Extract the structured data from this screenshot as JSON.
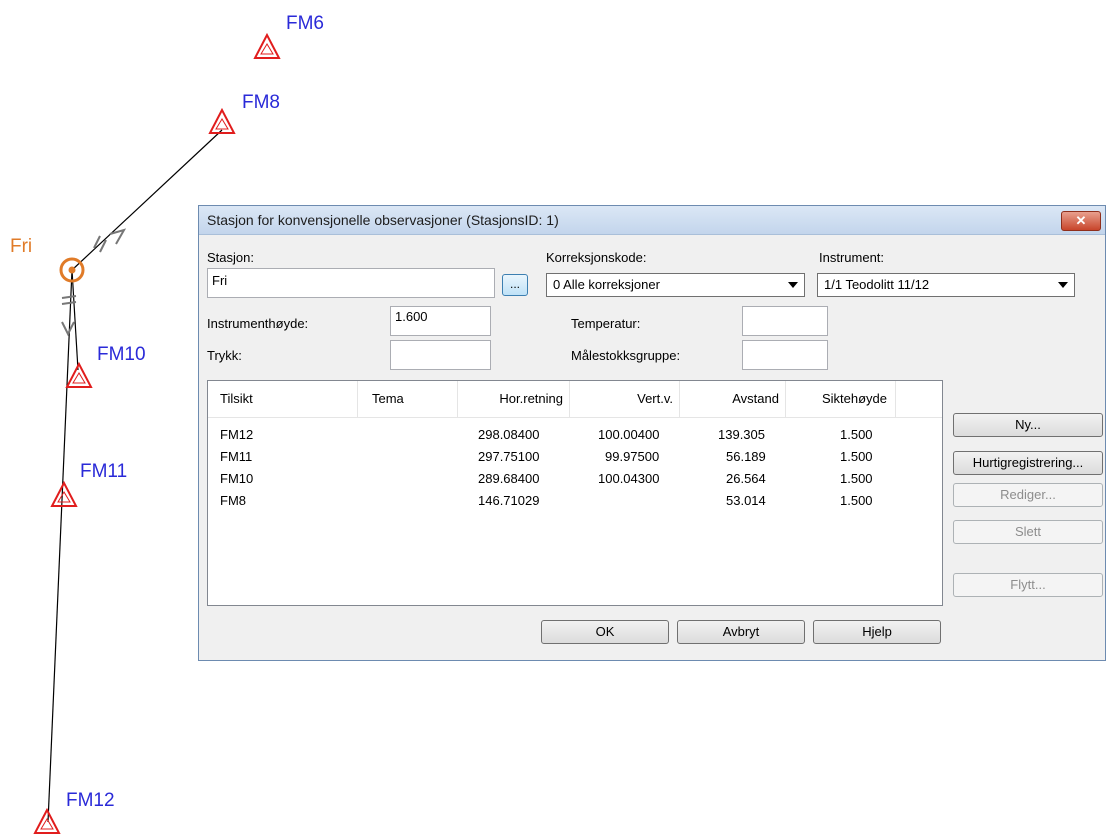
{
  "map": {
    "points": [
      {
        "name": "FM6"
      },
      {
        "name": "FM8"
      },
      {
        "name": "FM10"
      },
      {
        "name": "FM11"
      },
      {
        "name": "FM12"
      }
    ],
    "station_label": "Fri",
    "colors": {
      "point_symbol": "#e11d1d",
      "point_label": "#2a2ad8",
      "station": "#e07b28",
      "line": "#000000",
      "direction_marks": "#777777"
    }
  },
  "dialog": {
    "title": "Stasjon for konvensjonelle observasjoner (StasjonsID: 1)",
    "close_glyph": "✕",
    "stasjon_label": "Stasjon:",
    "stasjon_value": "Fri",
    "browse_label": "...",
    "korreksjonskode_label": "Korreksjonskode:",
    "korreksjonskode_value": "0  Alle korreksjoner",
    "instrument_label": "Instrument:",
    "instrument_value": "1/1   Teodolitt 11/12",
    "instrumenthoyde_label": "Instrumenthøyde:",
    "instrumenthoyde_value": "1.600",
    "trykk_label": "Trykk:",
    "trykk_value": "",
    "temperatur_label": "Temperatur:",
    "temperatur_value": "",
    "malestokk_label": "Målestokksgruppe:",
    "malestokk_value": "",
    "table": {
      "columns": [
        "Tilsikt",
        "Tema",
        "Hor.retning",
        "Vert.v.",
        "Avstand",
        "Siktehøyde"
      ],
      "rows": [
        [
          "FM12",
          "",
          "298.08400",
          "100.00400",
          "139.305",
          "1.500"
        ],
        [
          "FM11",
          "",
          "297.75100",
          "99.97500",
          "56.189",
          "1.500"
        ],
        [
          "FM10",
          "",
          "289.68400",
          "100.04300",
          "26.564",
          "1.500"
        ],
        [
          "FM8",
          "",
          "146.71029",
          "",
          "53.014",
          "1.500"
        ]
      ]
    },
    "side_buttons": {
      "ny": "Ny...",
      "hurtig": "Hurtigregistrering...",
      "rediger": "Rediger...",
      "slett": "Slett",
      "flytt": "Flytt..."
    },
    "bottom_buttons": {
      "ok": "OK",
      "avbryt": "Avbryt",
      "hjelp": "Hjelp"
    }
  }
}
